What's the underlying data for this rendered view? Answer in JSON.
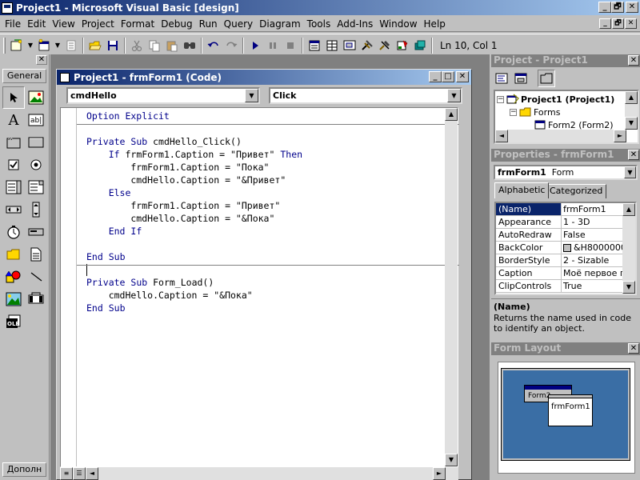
{
  "app": {
    "title": "Project1 - Microsoft Visual Basic [design]",
    "caption_buttons": [
      "_",
      "🗗",
      "✕"
    ]
  },
  "menu": [
    "File",
    "Edit",
    "View",
    "Project",
    "Format",
    "Debug",
    "Run",
    "Query",
    "Diagram",
    "Tools",
    "Add-Ins",
    "Window",
    "Help"
  ],
  "toolbar": {
    "status": "Ln 10, Col 1"
  },
  "toolbox": {
    "tab_general": "General",
    "tab_bottom": "Дополн"
  },
  "code_window": {
    "title": "Project1 - frmForm1 (Code)",
    "object_combo": "cmdHello",
    "proc_combo": "Click",
    "lines_section1": [
      "Option Explicit"
    ],
    "lines_section2": [
      "Private Sub cmdHello_Click()",
      "    If frmForm1.Caption = \"Привет\" Then",
      "        frmForm1.Caption = \"Пока\"",
      "        cmdHello.Caption = \"&Привет\"",
      "    Else",
      "        frmForm1.Caption = \"Привет\"",
      "        cmdHello.Caption = \"&Пока\"",
      "    End If",
      "",
      "End Sub"
    ],
    "lines_section3": [
      "Private Sub Form_Load()",
      "    cmdHello.Caption = \"&Пока\"",
      "End Sub"
    ]
  },
  "project_panel": {
    "title": "Project - Project1",
    "tree": {
      "root": "Project1 (Project1)",
      "forms_folder": "Forms",
      "form_item": "Form2 (Form2)"
    }
  },
  "properties_panel": {
    "title": "Properties - frmForm1",
    "object_name": "frmForm1",
    "object_type": "Form",
    "tabs": [
      "Alphabetic",
      "Categorized"
    ],
    "rows": [
      {
        "name": "(Name)",
        "value": "frmForm1"
      },
      {
        "name": "Appearance",
        "value": "1 - 3D"
      },
      {
        "name": "AutoRedraw",
        "value": "False"
      },
      {
        "name": "BackColor",
        "value": "&H8000000"
      },
      {
        "name": "BorderStyle",
        "value": "2 - Sizable"
      },
      {
        "name": "Caption",
        "value": "Моё первое пр"
      },
      {
        "name": "ClipControls",
        "value": "True"
      }
    ],
    "desc_title": "(Name)",
    "desc_text": "Returns the name used in code to identify an object."
  },
  "form_layout_panel": {
    "title": "Form Layout",
    "form_back_label": "Form2",
    "form_front_label": "frmForm1"
  },
  "colors": {
    "title_active": "#0a246a",
    "title_gradient_end": "#a6caf0",
    "keyword": "#00008b",
    "desktop_preview": "#3a6ea5"
  }
}
